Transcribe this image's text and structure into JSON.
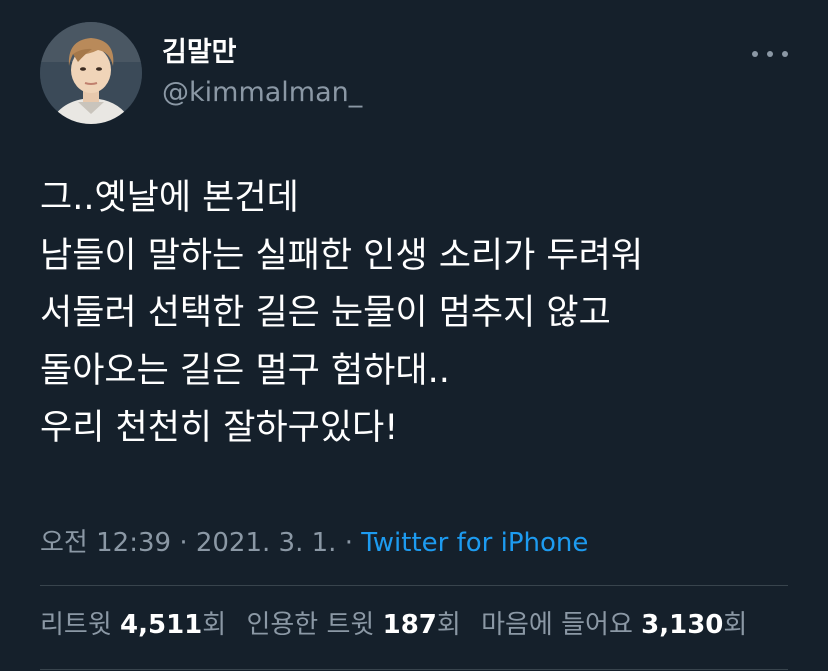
{
  "user": {
    "display_name": "김말만",
    "handle": "@kimmalman_"
  },
  "tweet": {
    "lines": [
      "그..옛날에 본건데",
      "남들이 말하는 실패한 인생 소리가 두려워",
      "서둘러 선택한 길은 눈물이 멈추지 않고",
      "돌아오는 길은 멀구 험하대..",
      "우리 천천히 잘하구있다!"
    ],
    "time": "오전 12:39",
    "separator": "·",
    "date": "2021. 3. 1.",
    "source": "Twitter for iPhone"
  },
  "stats": {
    "retweets": {
      "label": "리트윗",
      "count": "4,511",
      "suffix": "회"
    },
    "quotes": {
      "label": "인용한 트윗",
      "count": "187",
      "suffix": "회"
    },
    "likes": {
      "label": "마음에 들어요",
      "count": "3,130",
      "suffix": "회"
    }
  },
  "icons": {
    "more": "more-horizontal-icon",
    "avatar": "profile-photo"
  },
  "colors": {
    "background": "#15202b",
    "text": "#ffffff",
    "secondary": "#8b98a5",
    "link": "#1d9bf0",
    "divider": "#38444d"
  }
}
